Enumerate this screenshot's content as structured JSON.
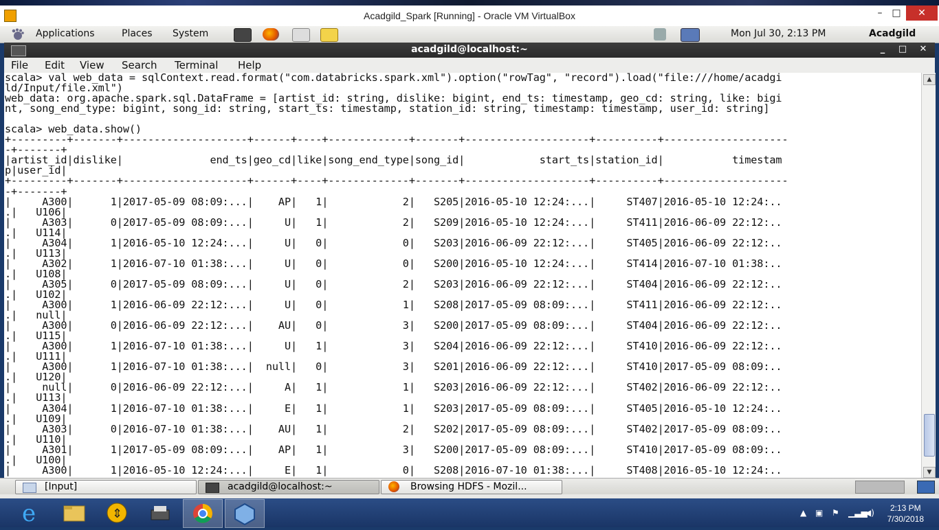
{
  "vbox": {
    "title": "Acadgild_Spark [Running] - Oracle VM VirtualBox",
    "min": "–",
    "max": "□",
    "close": "✕"
  },
  "gnome_panel": {
    "menus": [
      "Applications",
      "Places",
      "System"
    ],
    "datetime": "Mon Jul 30,  2:13 PM",
    "user": "Acadgild"
  },
  "terminal": {
    "title": "acadgild@localhost:~",
    "menu": [
      "File",
      "Edit",
      "View",
      "Search",
      "Terminal",
      "Help"
    ],
    "buttons": {
      "min": "_",
      "max": "□",
      "close": "✕"
    },
    "lines": [
      "scala> val web_data = sqlContext.read.format(\"com.databricks.spark.xml\").option(\"rowTag\", \"record\").load(\"file:///home/acadgi",
      "ld/Input/file.xml\")",
      "web_data: org.apache.spark.sql.DataFrame = [artist_id: string, dislike: bigint, end_ts: timestamp, geo_cd: string, like: bigi",
      "nt, song_end_type: bigint, song_id: string, start_ts: timestamp, station_id: string, timestamp: timestamp, user_id: string]",
      "",
      "scala> web_data.show()",
      "+---------+-------+--------------------+------+----+-------------+-------+--------------------+----------+--------------------",
      "-+-------+",
      "|artist_id|dislike|              end_ts|geo_cd|like|song_end_type|song_id|            start_ts|station_id|           timestam",
      "p|user_id|",
      "+---------+-------+--------------------+------+----+-------------+-------+--------------------+----------+--------------------",
      "-+-------+",
      "|     A300|      1|2017-05-09 08:09:...|    AP|   1|            2|   S205|2016-05-10 12:24:...|     ST407|2016-05-10 12:24:..",
      ".|   U106|",
      "|     A303|      0|2017-05-09 08:09:...|     U|   1|            2|   S209|2016-05-10 12:24:...|     ST411|2016-06-09 22:12:..",
      ".|   U114|",
      "|     A304|      1|2016-05-10 12:24:...|     U|   0|            0|   S203|2016-06-09 22:12:...|     ST405|2016-06-09 22:12:..",
      ".|   U113|",
      "|     A302|      1|2016-07-10 01:38:...|     U|   0|            0|   S200|2016-05-10 12:24:...|     ST414|2016-07-10 01:38:..",
      ".|   U108|",
      "|     A305|      0|2017-05-09 08:09:...|     U|   0|            2|   S203|2016-06-09 22:12:...|     ST404|2016-06-09 22:12:..",
      ".|   U102|",
      "|     A300|      1|2016-06-09 22:12:...|     U|   0|            1|   S208|2017-05-09 08:09:...|     ST411|2016-06-09 22:12:..",
      ".|   null|",
      "|     A300|      0|2016-06-09 22:12:...|    AU|   0|            3|   S200|2017-05-09 08:09:...|     ST404|2016-06-09 22:12:..",
      ".|   U115|",
      "|     A300|      1|2016-07-10 01:38:...|     U|   1|            3|   S204|2016-06-09 22:12:...|     ST410|2016-06-09 22:12:..",
      ".|   U111|",
      "|     A300|      1|2016-07-10 01:38:...|  null|   0|            3|   S201|2016-06-09 22:12:...|     ST410|2017-05-09 08:09:..",
      ".|   U120|",
      "|     null|      0|2016-06-09 22:12:...|     A|   1|            1|   S203|2016-06-09 22:12:...|     ST402|2016-06-09 22:12:..",
      ".|   U113|",
      "|     A304|      1|2016-07-10 01:38:...|     E|   1|            1|   S203|2017-05-09 08:09:...|     ST405|2016-05-10 12:24:..",
      ".|   U109|",
      "|     A303|      0|2016-07-10 01:38:...|    AU|   1|            2|   S202|2017-05-09 08:09:...|     ST402|2017-05-09 08:09:..",
      ".|   U110|",
      "|     A301|      1|2017-05-09 08:09:...|    AP|   1|            3|   S200|2017-05-09 08:09:...|     ST410|2017-05-09 08:09:..",
      ".|   U100|",
      "|     A300|      1|2016-05-10 12:24:...|     E|   1|            0|   S208|2016-07-10 01:38:...|     ST408|2016-05-10 12:24:.."
    ]
  },
  "bottom_panel": {
    "tasks": [
      {
        "label": "[Input]"
      },
      {
        "label": "acadgild@localhost:~"
      },
      {
        "label": "Browsing HDFS - Mozil..."
      }
    ]
  },
  "windows_taskbar": {
    "time": "2:13 PM",
    "date": "7/30/2018"
  }
}
